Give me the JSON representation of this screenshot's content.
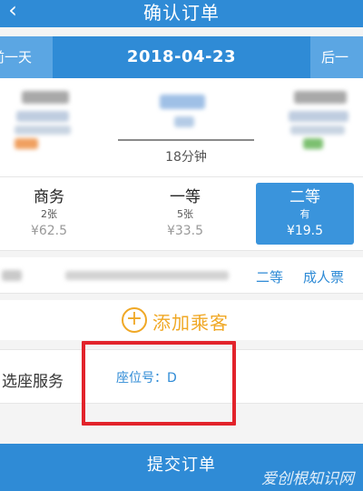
{
  "header": {
    "back_icon": "chevron-left-icon",
    "title": "确认订单"
  },
  "date_nav": {
    "prev_label": "前一天",
    "date": "2018-04-23",
    "next_label": "后一"
  },
  "train": {
    "duration": "18分钟"
  },
  "seat_options": [
    {
      "class": "商务",
      "count": "2张",
      "price": "¥62.5",
      "selected": false
    },
    {
      "class": "一等",
      "count": "5张",
      "price": "¥33.5",
      "selected": false
    },
    {
      "class": "二等",
      "count": "有",
      "price": "¥19.5",
      "selected": true
    }
  ],
  "passenger": {
    "seat_class": "二等",
    "ticket_type": "成人票"
  },
  "add_passenger": {
    "label": "添加乘客"
  },
  "seat_service": {
    "label": "选座服务",
    "seat_number": "座位号：D"
  },
  "footer": {
    "submit_label": "提交订单",
    "watermark": "爱创根知识网"
  },
  "colors": {
    "primary": "#2f8bd6",
    "accent": "#f0a825",
    "highlight": "#e2232b"
  }
}
